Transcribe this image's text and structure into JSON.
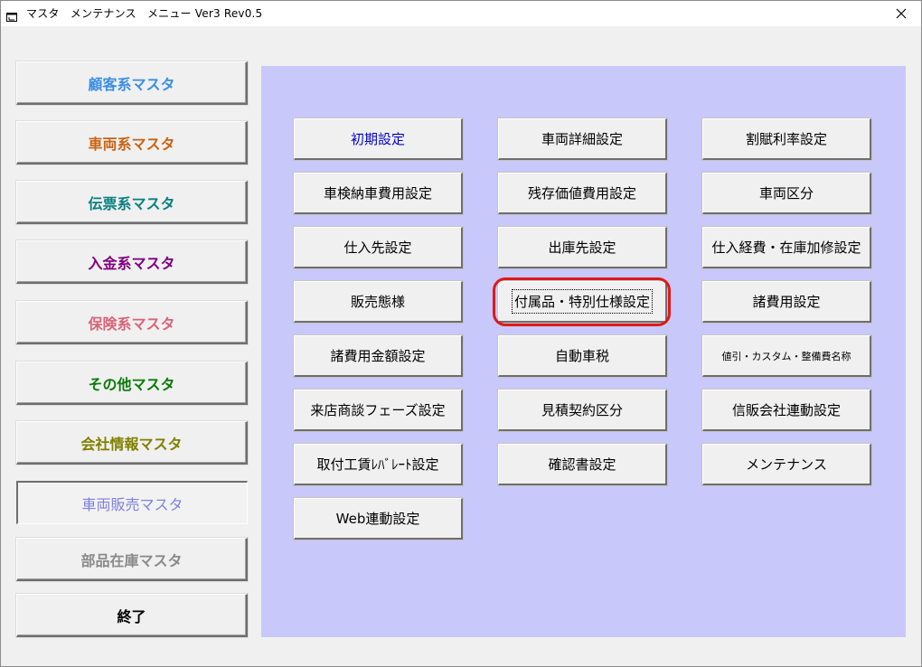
{
  "window": {
    "title": "マスタ　メンテナンス　メニュー Ver3 Rev0.5",
    "app_icon": "app-window-icon",
    "close_icon": "close-icon"
  },
  "left_menu": [
    {
      "label": "顧客系マスタ",
      "color": "#3a8ee6"
    },
    {
      "label": "車両系マスタ",
      "color": "#c86414"
    },
    {
      "label": "伝票系マスタ",
      "color": "#0a8080"
    },
    {
      "label": "入金系マスタ",
      "color": "#800080"
    },
    {
      "label": "保険系マスタ",
      "color": "#d86478"
    },
    {
      "label": "その他マスタ",
      "color": "#0a7a0a"
    },
    {
      "label": "会社情報マスタ",
      "color": "#808000"
    },
    {
      "label": "車両販売マスタ",
      "color": "#8080e0",
      "state": "selected"
    },
    {
      "label": "部品在庫マスタ",
      "color": "#8a8a8a",
      "state": "disabled"
    },
    {
      "label": "終了",
      "color": "#000000"
    }
  ],
  "panel": {
    "background": "#c8c8fa",
    "buttons": {
      "col1": [
        "初期設定",
        "車検納車費用設定",
        "仕入先設定",
        "販売態様",
        "諸費用金額設定",
        "来店商談フェーズ設定",
        "取付工賃ﾚﾊﾞﾚｰﾄ設定",
        "Web連動設定"
      ],
      "col2": [
        "車両詳細設定",
        "残存価値費用設定",
        "出庫先設定",
        "付属品・特別仕様設定",
        "自動車税",
        "見積契約区分",
        "確認書設定"
      ],
      "col3": [
        "割賦利率設定",
        "車両区分",
        "仕入経費・在庫加修設定",
        "諸費用設定",
        "値引・カスタム・整備費名称",
        "信販会社連動設定",
        "メンテナンス"
      ]
    },
    "focused_button": "付属品・特別仕様設定",
    "highlight_color": "#e01818"
  }
}
